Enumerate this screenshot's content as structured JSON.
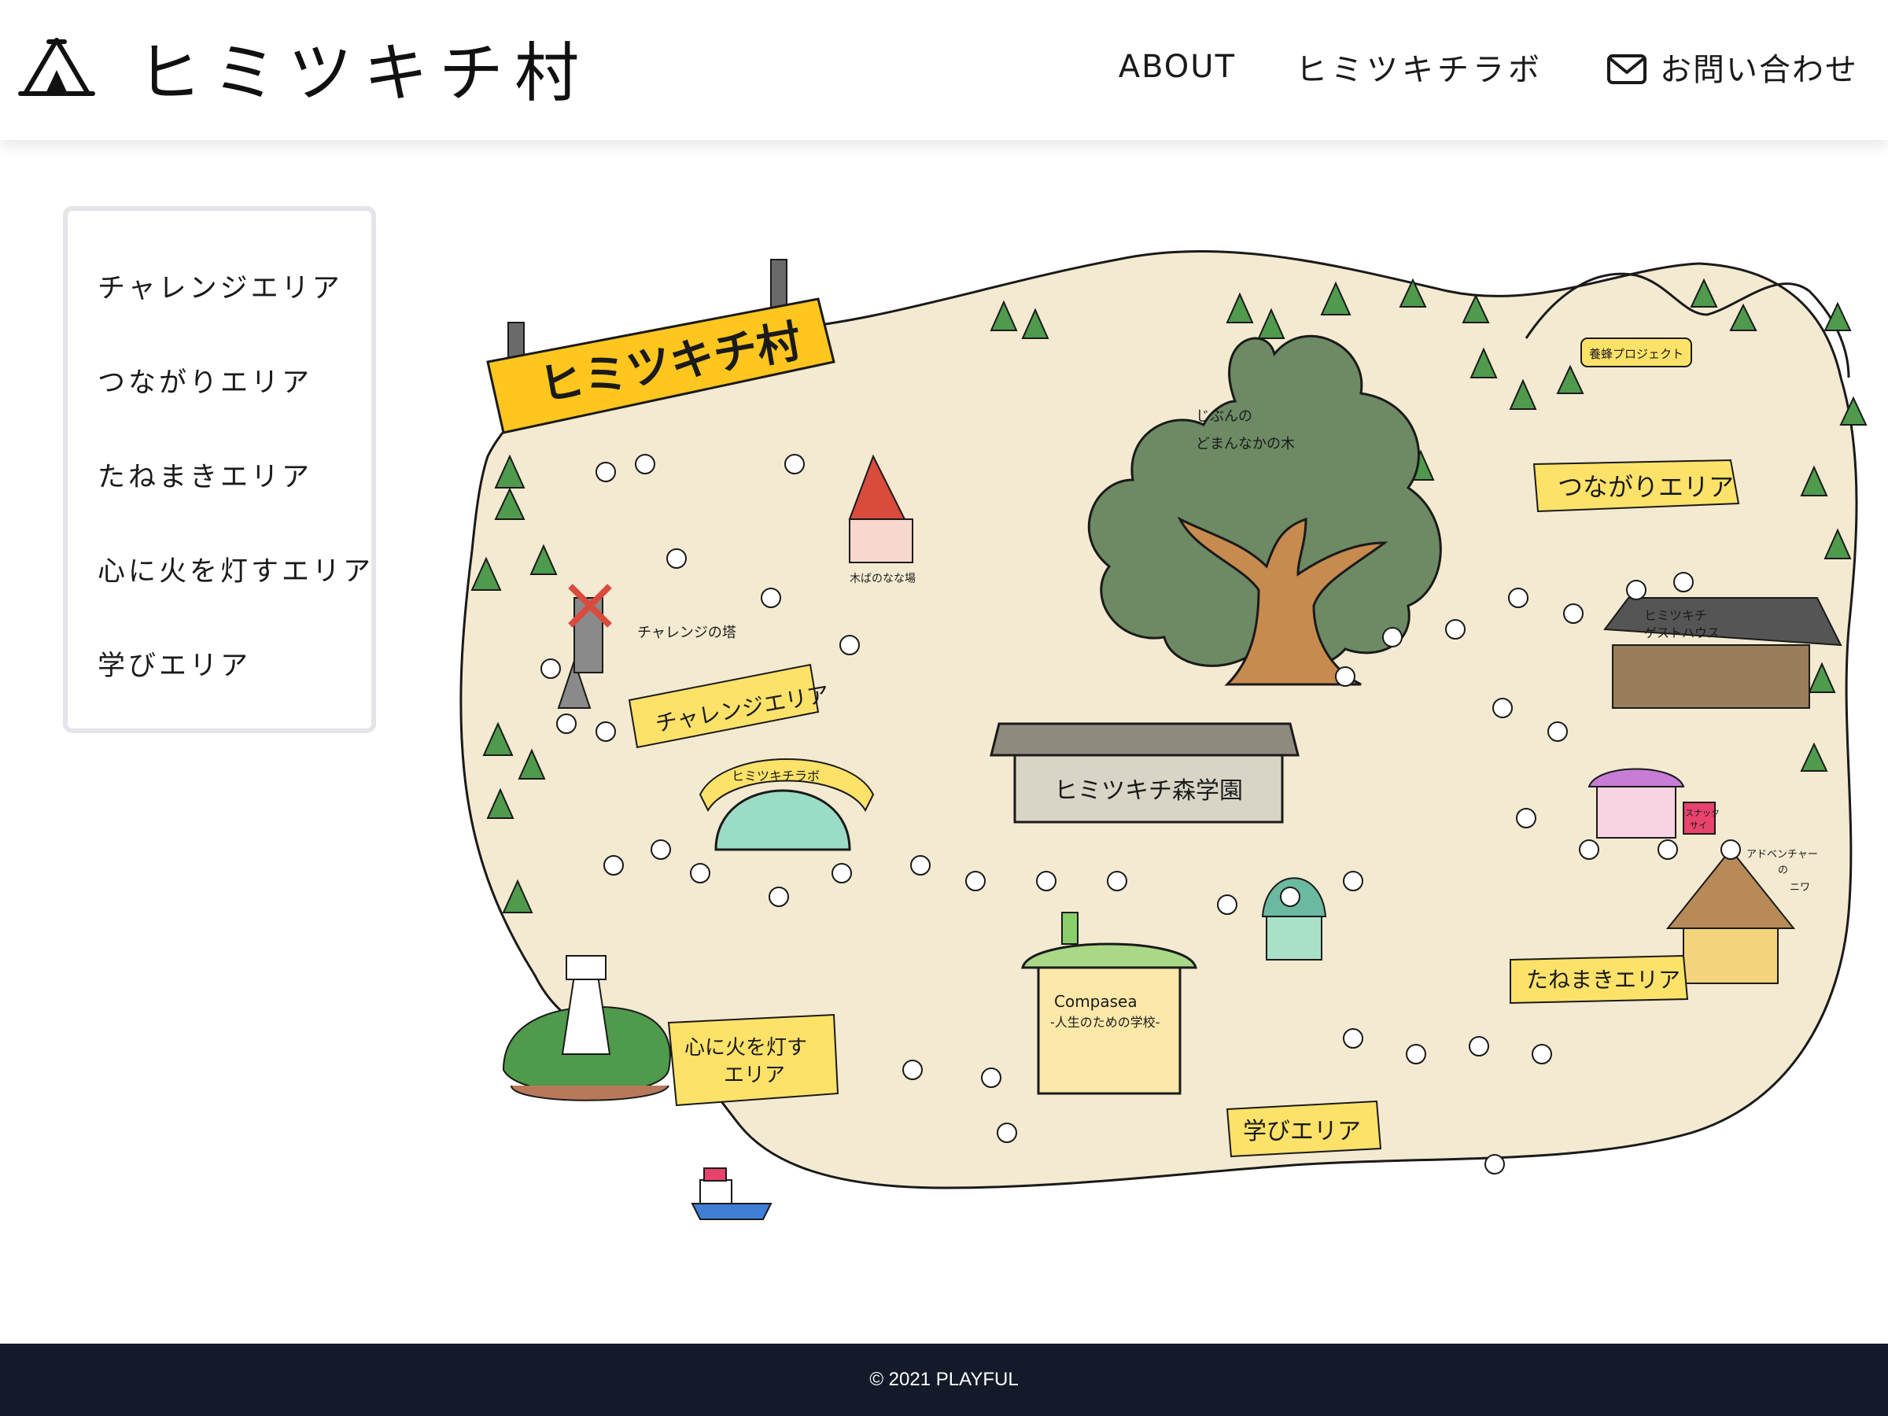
{
  "header": {
    "logo_text": "ヒミツキチ村",
    "nav": {
      "about": "ABOUT",
      "lab": "ヒミツキチラボ",
      "contact": "お問い合わせ"
    }
  },
  "sidebar": {
    "items": [
      {
        "label": "チャレンジエリア"
      },
      {
        "label": "つながりエリア"
      },
      {
        "label": "たねまきエリア"
      },
      {
        "label": "心に火を灯すエリア"
      },
      {
        "label": "学びエリア"
      }
    ]
  },
  "map": {
    "sign_title": "ヒミツキチ村",
    "tree_label_line1": "じぶんの",
    "tree_label_line2": "どまんなかの木",
    "school_label": "ヒミツキチ森学園",
    "lab_label": "ヒミツキチラボ",
    "challenge_tower_label": "チャレンジの塔",
    "hut_label": "木ばのなな場",
    "guesthouse_label_line1": "ヒミツキチ",
    "guesthouse_label_line2": "ゲストハウス",
    "project_label": "養蜂プロジェクト",
    "shop_label_line1": "スナック",
    "shop_label_line2": "サイ",
    "compass_label_line1": "Compasea",
    "compass_label_line2": "-人生のための学校-",
    "adventure_label_line1": "アドベンチャー",
    "adventure_label_line2": "の",
    "adventure_label_line3": "ニワ",
    "areas": {
      "tsunagari": "つながりエリア",
      "challenge": "チャレンジエリア",
      "tanemaki": "たねまきエリア",
      "kokoro_line1": "心に火を灯す",
      "kokoro_line2": "エリア",
      "manabi": "学びエリア"
    }
  },
  "footer": {
    "copyright": "© 2021 PLAYFUL"
  },
  "colors": {
    "land": "#f3ead1",
    "label_yellow": "#fde26a",
    "big_tree": "#6d8a64",
    "trunk": "#c78a4f",
    "footer_bg": "#141a2a",
    "sidebar_border": "#e4e4ea"
  }
}
